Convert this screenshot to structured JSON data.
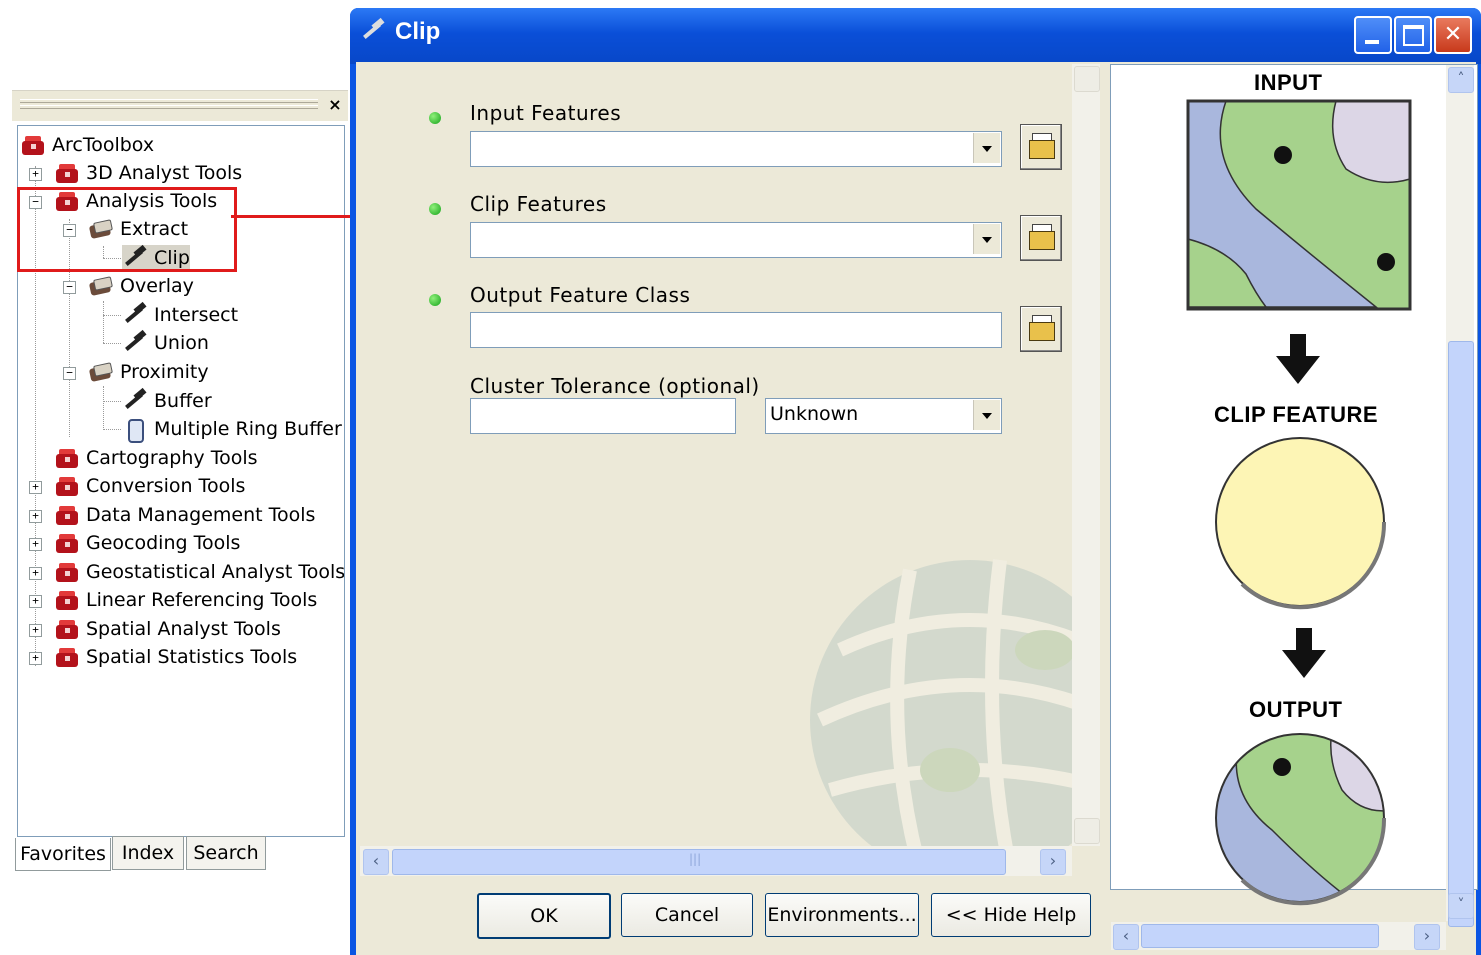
{
  "toolbox": {
    "close_label": "×",
    "tree": [
      {
        "label": "ArcToolbox",
        "icon": "toolbox-root-icon"
      },
      {
        "label": "3D Analyst Tools",
        "icon": "toolbox-icon",
        "expander": "+"
      },
      {
        "label": "Analysis Tools",
        "icon": "toolbox-icon",
        "expander": "−"
      },
      {
        "label": "Extract",
        "icon": "toolset-icon",
        "expander": "−"
      },
      {
        "label": "Clip",
        "icon": "hammer-tool-icon",
        "selected": true
      },
      {
        "label": "Overlay",
        "icon": "toolset-icon",
        "expander": "−"
      },
      {
        "label": "Intersect",
        "icon": "hammer-tool-icon"
      },
      {
        "label": "Union",
        "icon": "hammer-tool-icon"
      },
      {
        "label": "Proximity",
        "icon": "toolset-icon",
        "expander": "−"
      },
      {
        "label": "Buffer",
        "icon": "hammer-tool-icon"
      },
      {
        "label": "Multiple Ring Buffer",
        "icon": "script-tool-icon"
      },
      {
        "label": "Cartography Tools",
        "icon": "toolbox-icon"
      },
      {
        "label": "Conversion Tools",
        "icon": "toolbox-icon",
        "expander": "+"
      },
      {
        "label": "Data Management Tools",
        "icon": "toolbox-icon",
        "expander": "+"
      },
      {
        "label": "Geocoding Tools",
        "icon": "toolbox-icon",
        "expander": "+"
      },
      {
        "label": "Geostatistical Analyst Tools",
        "icon": "toolbox-icon",
        "expander": "+"
      },
      {
        "label": "Linear Referencing Tools",
        "icon": "toolbox-icon",
        "expander": "+"
      },
      {
        "label": "Spatial Analyst Tools",
        "icon": "toolbox-icon",
        "expander": "+"
      },
      {
        "label": "Spatial Statistics Tools",
        "icon": "toolbox-icon",
        "expander": "+"
      }
    ],
    "tabs": [
      "Favorites",
      "Index",
      "Search"
    ],
    "highlight_color": "#e01b1b"
  },
  "dialog": {
    "title": "Clip",
    "params": {
      "input_features": {
        "label": "Input Features",
        "value": ""
      },
      "clip_features": {
        "label": "Clip Features",
        "value": ""
      },
      "output_feature_class": {
        "label": "Output Feature Class",
        "value": ""
      },
      "cluster_tolerance": {
        "label": "Cluster Tolerance (optional)",
        "value": "",
        "unit": "Unknown"
      }
    },
    "buttons": {
      "ok": "OK",
      "cancel": "Cancel",
      "environments": "Environments...",
      "hide_help": "<< Hide Help"
    },
    "hscroll_grip": "|||"
  },
  "help": {
    "input_title": "INPUT",
    "clip_title": "CLIP FEATURE",
    "output_title": "OUTPUT",
    "colors": {
      "green": "#a6d28c",
      "blue": "#a9b7dd",
      "lavender": "#dcd6e6",
      "yellow": "#fdf5b5"
    }
  }
}
